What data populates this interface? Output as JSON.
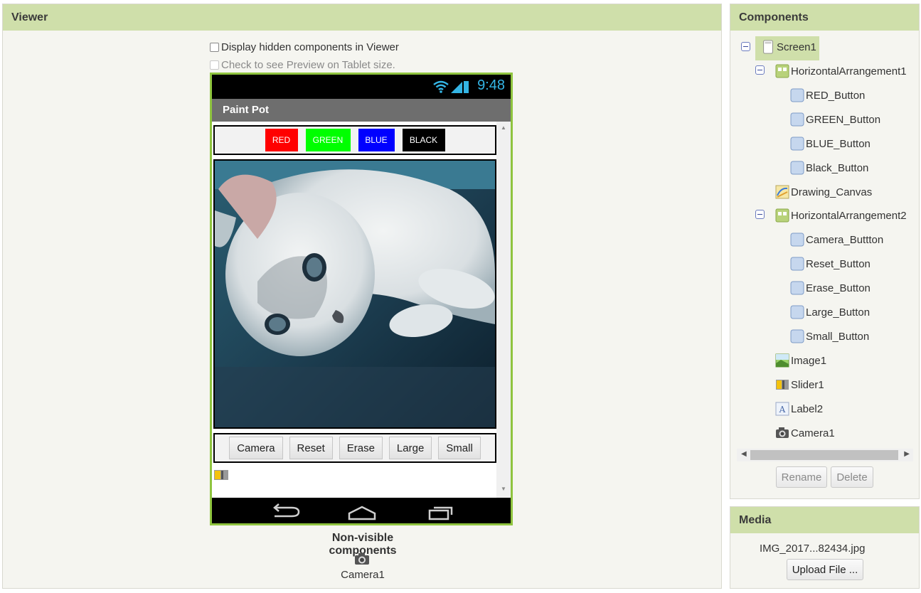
{
  "viewer": {
    "title": "Viewer",
    "display_hidden_label": "Display hidden components in Viewer",
    "tablet_preview_label": "Check to see Preview on Tablet size.",
    "phone": {
      "status_time": "9:48",
      "app_title": "Paint Pot",
      "color_buttons": [
        {
          "label": "RED",
          "color": "#ff0000"
        },
        {
          "label": "GREEN",
          "color": "#00ff00"
        },
        {
          "label": "BLUE",
          "color": "#0000ff"
        },
        {
          "label": "BLACK",
          "color": "#000000"
        }
      ],
      "action_buttons": [
        "Camera",
        "Reset",
        "Erase",
        "Large",
        "Small"
      ]
    },
    "non_visible_title": "Non-visible components",
    "non_visible_items": [
      "Camera1"
    ]
  },
  "components": {
    "title": "Components",
    "tree": [
      {
        "label": "Screen1",
        "icon": "screen-icon"
      },
      {
        "label": "HorizontalArrangement1",
        "icon": "arrangement-icon"
      },
      {
        "label": "RED_Button",
        "icon": "button-icon"
      },
      {
        "label": "GREEN_Button",
        "icon": "button-icon"
      },
      {
        "label": "BLUE_Button",
        "icon": "button-icon"
      },
      {
        "label": "Black_Button",
        "icon": "button-icon"
      },
      {
        "label": "Drawing_Canvas",
        "icon": "canvas-icon"
      },
      {
        "label": "HorizontalArrangement2",
        "icon": "arrangement-icon"
      },
      {
        "label": "Camera_Buttton",
        "icon": "button-icon"
      },
      {
        "label": "Reset_Button",
        "icon": "button-icon"
      },
      {
        "label": "Erase_Button",
        "icon": "button-icon"
      },
      {
        "label": "Large_Button",
        "icon": "button-icon"
      },
      {
        "label": "Small_Button",
        "icon": "button-icon"
      },
      {
        "label": "Image1",
        "icon": "image-icon"
      },
      {
        "label": "Slider1",
        "icon": "slider-icon"
      },
      {
        "label": "Label2",
        "icon": "label-icon"
      },
      {
        "label": "Camera1",
        "icon": "camera-icon"
      }
    ],
    "rename_label": "Rename",
    "delete_label": "Delete"
  },
  "media": {
    "title": "Media",
    "file_name": "IMG_2017...82434.jpg",
    "upload_label": "Upload File ..."
  },
  "colors": {
    "header_green": "#cfdfaa",
    "phone_border": "#8fc43f",
    "status_time": "#34b5e5"
  }
}
